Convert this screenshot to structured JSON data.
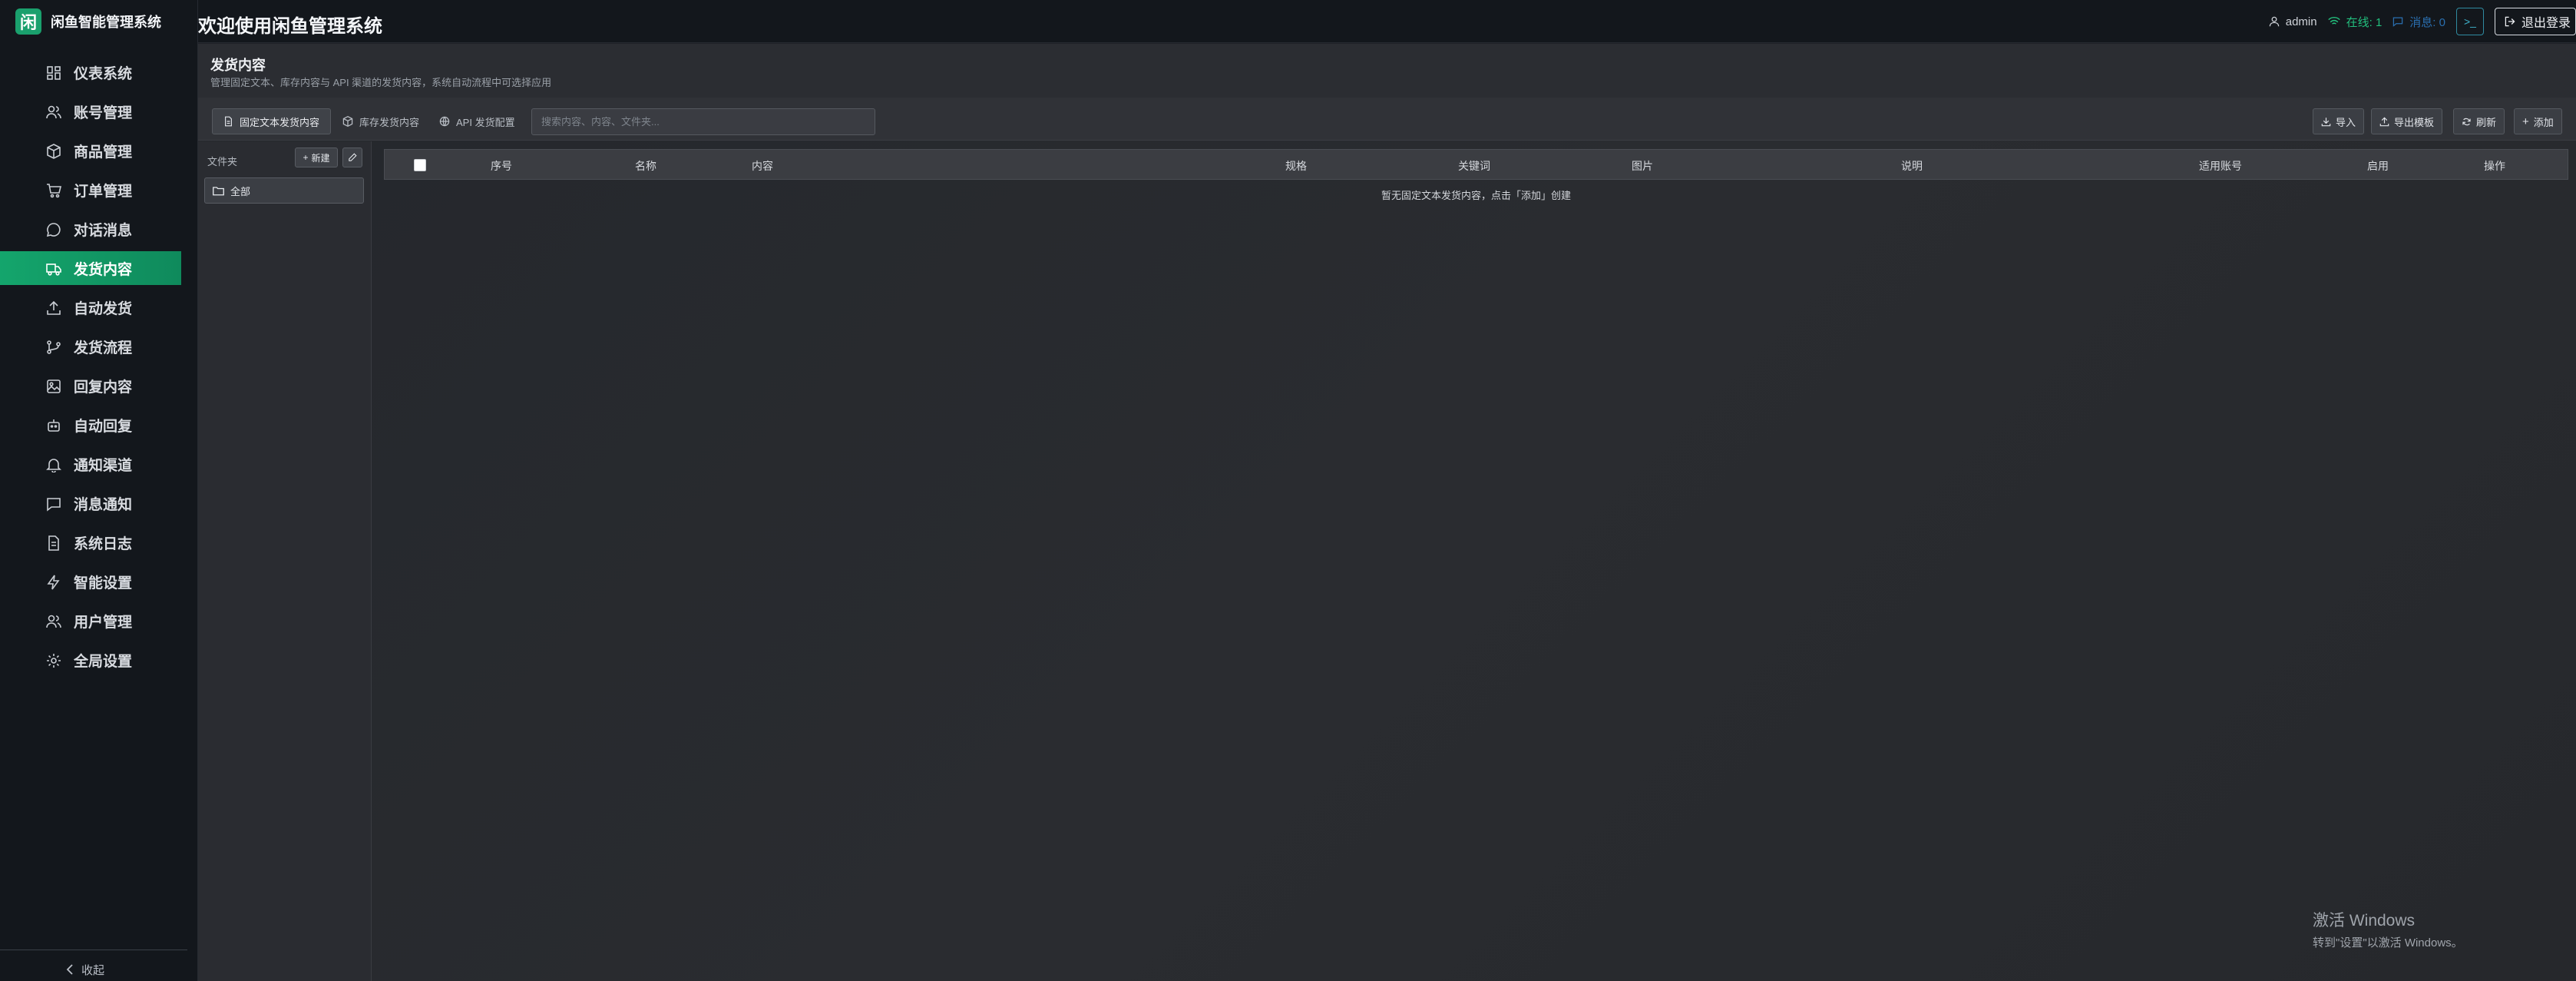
{
  "brand": {
    "logo_char": "闲",
    "name": "闲鱼智能管理系统"
  },
  "topbar": {
    "welcome": "欢迎使用闲鱼管理系统",
    "user": "admin",
    "online": "在线: 1",
    "messages": "消息: 0",
    "terminal": ">_",
    "logout": "退出登录"
  },
  "sidebar": {
    "items": [
      {
        "label": "仪表系统",
        "icon": "dashboard-icon"
      },
      {
        "label": "账号管理",
        "icon": "users-icon"
      },
      {
        "label": "商品管理",
        "icon": "box-icon"
      },
      {
        "label": "订单管理",
        "icon": "cart-icon"
      },
      {
        "label": "对话消息",
        "icon": "chat-icon"
      },
      {
        "label": "发货内容",
        "icon": "truck-icon",
        "active": true
      },
      {
        "label": "自动发货",
        "icon": "upload-icon"
      },
      {
        "label": "发货流程",
        "icon": "flow-icon"
      },
      {
        "label": "回复内容",
        "icon": "image-icon"
      },
      {
        "label": "自动回复",
        "icon": "bot-icon"
      },
      {
        "label": "通知渠道",
        "icon": "bell-icon"
      },
      {
        "label": "消息通知",
        "icon": "message-icon"
      },
      {
        "label": "系统日志",
        "icon": "doc-icon"
      },
      {
        "label": "智能设置",
        "icon": "bolt-icon"
      },
      {
        "label": "用户管理",
        "icon": "users-icon"
      },
      {
        "label": "全局设置",
        "icon": "gear-icon"
      }
    ],
    "collapse": "收起"
  },
  "page": {
    "title": "发货内容",
    "description": "管理固定文本、库存内容与 API 渠道的发货内容，系统自动流程中可选择应用"
  },
  "toolbar": {
    "tabs": [
      {
        "label": "固定文本发货内容",
        "active": true
      },
      {
        "label": "库存发货内容"
      },
      {
        "label": "API 发货配置"
      }
    ],
    "search_placeholder": "搜索内容、内容、文件夹...",
    "import": "导入",
    "export": "导出模板",
    "refresh": "刷新",
    "add": "添加"
  },
  "folders": {
    "header": "文件夹",
    "new_label": "新建",
    "items": [
      {
        "label": "全部"
      }
    ]
  },
  "table": {
    "columns": [
      "序号",
      "名称",
      "内容",
      "规格",
      "关键词",
      "图片",
      "说明",
      "适用账号",
      "启用",
      "操作"
    ],
    "empty_text": "暂无固定文本发货内容，点击「添加」创建"
  },
  "watermark": {
    "line1": "激活 Windows",
    "line2": "转到\"设置\"以激活 Windows。"
  },
  "colors": {
    "accent": "#14a56c",
    "sidebar_bg": "#13171c",
    "main_bg": "#24272c"
  }
}
